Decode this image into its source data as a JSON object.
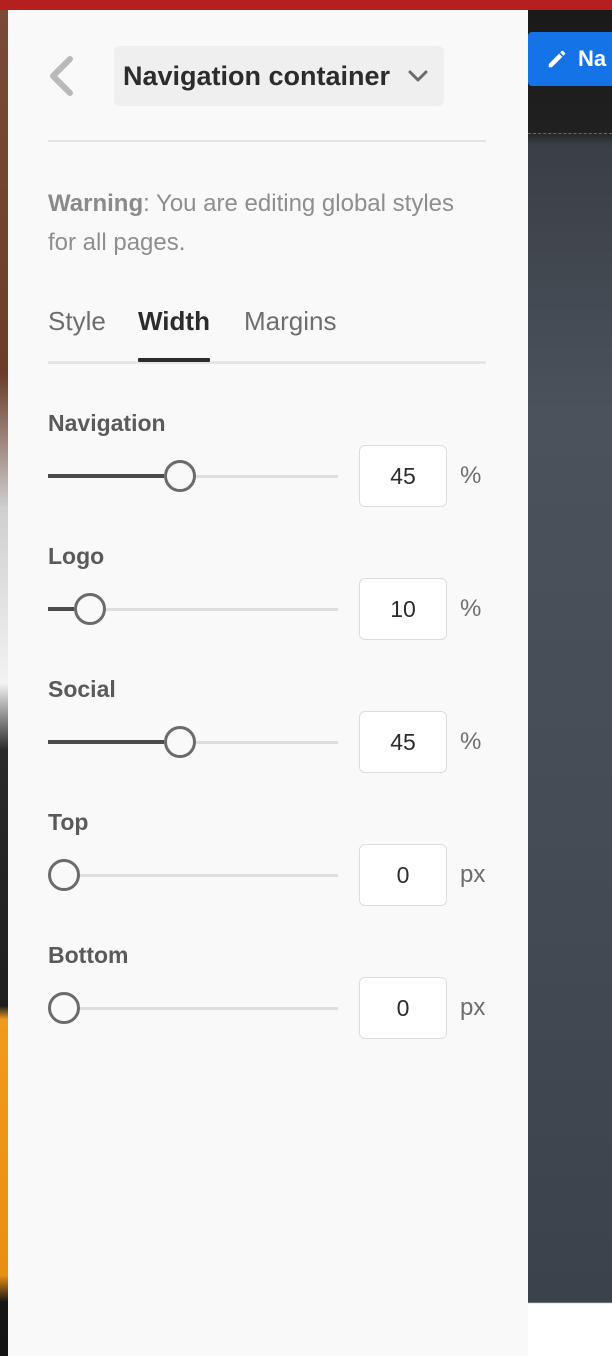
{
  "panel": {
    "title": "Navigation container",
    "warning_label": "Warning",
    "warning_text": ": You are editing global styles for all pages.",
    "tabs": [
      {
        "label": "Style",
        "active": false
      },
      {
        "label": "Width",
        "active": true
      },
      {
        "label": "Margins",
        "active": false
      }
    ],
    "rows": [
      {
        "label": "Navigation",
        "value": "45",
        "unit": "%",
        "fraction": 0.45
      },
      {
        "label": "Logo",
        "value": "10",
        "unit": "%",
        "fraction": 0.1
      },
      {
        "label": "Social",
        "value": "45",
        "unit": "%",
        "fraction": 0.45
      },
      {
        "label": "Top",
        "value": "0",
        "unit": "px",
        "fraction": 0.0
      },
      {
        "label": "Bottom",
        "value": "0",
        "unit": "px",
        "fraction": 0.0
      }
    ]
  },
  "canvas": {
    "edit_button_label": "Na"
  },
  "colors": {
    "accent": "#1473e6",
    "top_bar": "#b51f1f",
    "panel_bg": "#f9f9f9"
  },
  "icons": {
    "back": "chevron-left-icon",
    "dropdown": "chevron-down-icon",
    "edit": "pencil-icon"
  }
}
